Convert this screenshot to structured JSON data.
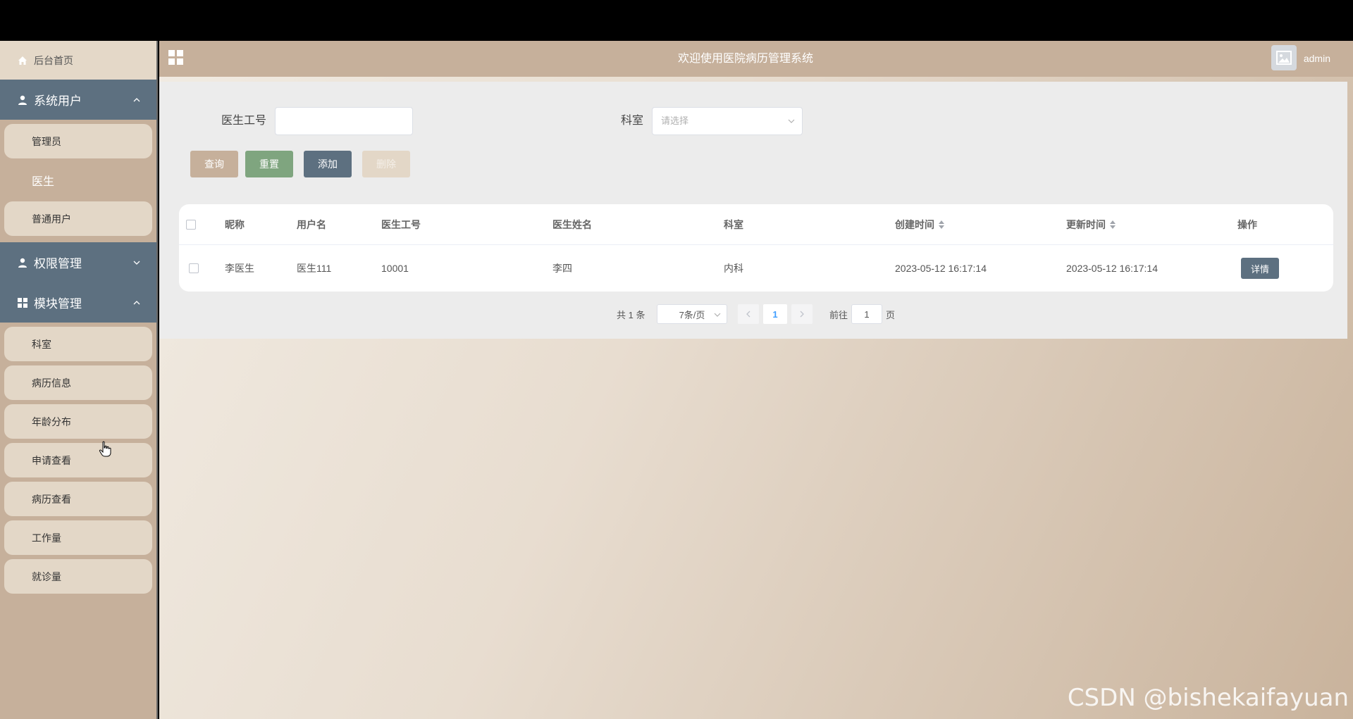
{
  "sidebar": {
    "home_label": "后台首页",
    "groups": [
      {
        "label": "系统用户",
        "expanded": true,
        "icon": "user-icon",
        "items": [
          {
            "label": "管理员",
            "active": false
          },
          {
            "label": "医生",
            "active": true
          },
          {
            "label": "普通用户",
            "active": false
          }
        ]
      },
      {
        "label": "权限管理",
        "expanded": false,
        "icon": "user-icon",
        "items": []
      },
      {
        "label": "模块管理",
        "expanded": true,
        "icon": "grid-icon",
        "items": [
          {
            "label": "科室"
          },
          {
            "label": "病历信息"
          },
          {
            "label": "年龄分布"
          },
          {
            "label": "申请查看"
          },
          {
            "label": "病历查看"
          },
          {
            "label": "工作量"
          },
          {
            "label": "就诊量"
          }
        ]
      }
    ]
  },
  "header": {
    "title": "欢迎使用医院病历管理系统",
    "username": "admin"
  },
  "search": {
    "doctor_id_label": "医生工号",
    "doctor_id_value": "",
    "dept_label": "科室",
    "dept_placeholder": "请选择"
  },
  "buttons": {
    "query": "查询",
    "reset": "重置",
    "add": "添加",
    "delete": "删除"
  },
  "table": {
    "columns": [
      "昵称",
      "用户名",
      "医生工号",
      "医生姓名",
      "科室",
      "创建时间",
      "更新时间",
      "操作"
    ],
    "rows": [
      {
        "nickname": "李医生",
        "username": "医生111",
        "doctor_id": "10001",
        "doctor_name": "李四",
        "dept": "内科",
        "created": "2023-05-12 16:17:14",
        "updated": "2023-05-12 16:17:14",
        "action": "详情"
      }
    ]
  },
  "pagination": {
    "total_text": "共 1 条",
    "page_size": "7条/页",
    "current_page": "1",
    "goto_label": "前往",
    "goto_value": "1",
    "page_suffix": "页"
  },
  "watermark": "CSDN @bishekaifayuan",
  "colors": {
    "sidebar_bg": "#c6b09b",
    "group_bg": "#5d7080",
    "item_bg": "#e3d7c7",
    "query_btn": "#c6b09b",
    "reset_btn": "#7fa57f",
    "add_btn": "#5d7080",
    "delete_btn": "#e3d7c7"
  }
}
